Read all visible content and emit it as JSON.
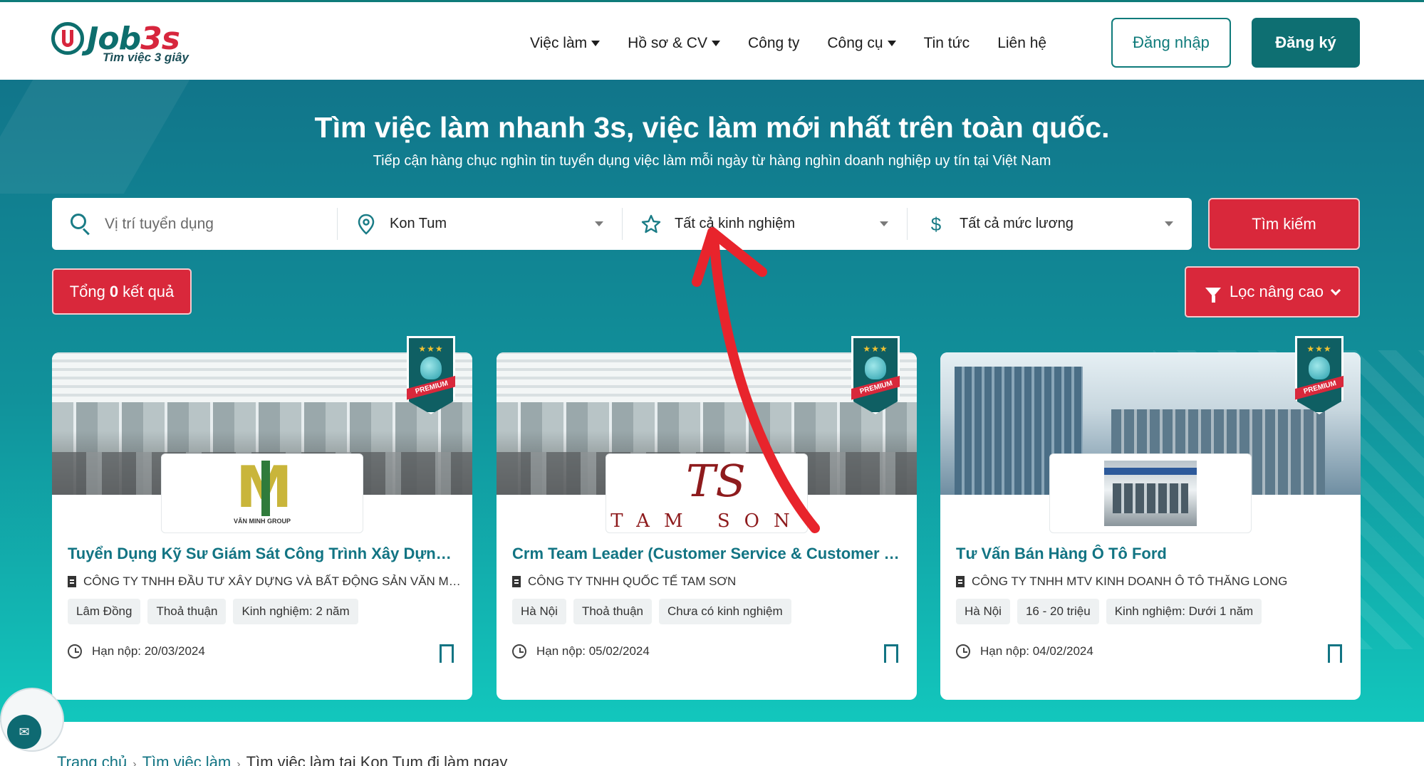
{
  "header": {
    "logo_name": "Job3s",
    "logo_tagline": "Tìm việc 3 giây",
    "nav": [
      {
        "label": "Việc làm",
        "has_dropdown": true
      },
      {
        "label": "Hồ sơ & CV",
        "has_dropdown": true
      },
      {
        "label": "Công ty",
        "has_dropdown": false
      },
      {
        "label": "Công cụ",
        "has_dropdown": true
      },
      {
        "label": "Tin tức",
        "has_dropdown": false
      },
      {
        "label": "Liên hệ",
        "has_dropdown": false
      }
    ],
    "login_label": "Đăng nhập",
    "register_label": "Đăng ký"
  },
  "hero": {
    "title": "Tìm việc làm nhanh 3s, việc làm mới nhất trên toàn quốc.",
    "subtitle": "Tiếp cận hàng chục nghìn tin tuyển dụng việc làm mỗi ngày từ hàng nghìn doanh nghiệp uy tín tại Việt Nam"
  },
  "search": {
    "position_placeholder": "Vị trí tuyển dụng",
    "location_value": "Kon Tum",
    "experience_value": "Tất cả kinh nghiệm",
    "salary_value": "Tất cả mức lương",
    "button_label": "Tìm kiếm"
  },
  "results": {
    "total_prefix": "Tổng",
    "total_count": "0",
    "total_suffix": "kết quả"
  },
  "filter": {
    "label": "Lọc nâng cao"
  },
  "badge": {
    "premium_label": "PREMIUM",
    "stars": "★★★"
  },
  "jobs": [
    {
      "title": "Tuyển Dụng Kỹ Sư Giám Sát Công Trình Xây Dựng Ở ...",
      "company": "CÔNG TY TNHH ĐẦU TƯ XÂY DỰNG VÀ BẤT ĐỘNG SẢN VĂN MINH...",
      "logo_text": "VĂN MINH GROUP",
      "logo_letter": "M",
      "tags": [
        "Lâm Đồng",
        "Thoả thuận",
        "Kinh nghiệm: 2 năm"
      ],
      "deadline": "Hạn nộp: 20/03/2024"
    },
    {
      "title": "Crm Team Leader (Customer Service & Customer Ex...",
      "company": "CÔNG TY TNHH QUỐC TẾ TAM SƠN",
      "logo_text": "TAM SON",
      "logo_letter": "TS",
      "tags": [
        "Hà Nội",
        "Thoả thuận",
        "Chưa có kinh nghiệm"
      ],
      "deadline": "Hạn nộp: 05/02/2024"
    },
    {
      "title": "Tư Vấn Bán Hàng Ô Tô Ford",
      "company": "CÔNG TY TNHH MTV KINH DOANH Ô TÔ THĂNG LONG",
      "tags": [
        "Hà Nội",
        "16 - 20 triệu",
        "Kinh nghiệm: Dưới 1 năm"
      ],
      "deadline": "Hạn nộp: 04/02/2024"
    }
  ],
  "breadcrumb": {
    "items": [
      "Trang chủ",
      "Tìm việc làm",
      "Tìm việc làm tại Kon Tum đi làm ngay"
    ],
    "separator": "›"
  },
  "colors": {
    "brand_teal": "#0e6f72",
    "accent_red": "#d9283b",
    "title_teal": "#127483",
    "annotation_arrow": "#e8242c"
  }
}
